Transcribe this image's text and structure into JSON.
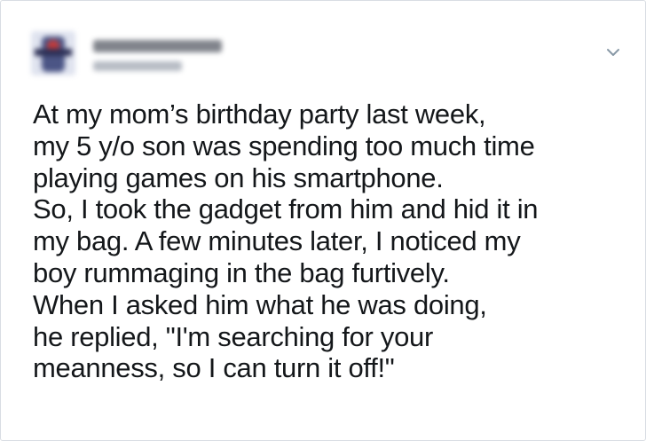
{
  "tweet": {
    "author": {
      "avatar_icon": "blurred-avatar",
      "name_redacted": true,
      "handle_redacted": true
    },
    "menu_icon": "chevron-down-icon",
    "lines": [
      "At my mom’s birthday party last week,",
      "my 5 y/o son was spending too much time",
      "playing games on his smartphone.",
      "So, I took the gadget from him and hid it in",
      "my bag. A few minutes later, I noticed my",
      "boy rummaging in the bag furtively.",
      "When I asked him what he was doing,",
      "he replied, \"I'm searching for your",
      "meanness, so I can turn it off!\""
    ]
  },
  "colors": {
    "text": "#14171a",
    "border": "#d9dde3",
    "chevron": "#8899a6",
    "background": "#ffffff"
  }
}
